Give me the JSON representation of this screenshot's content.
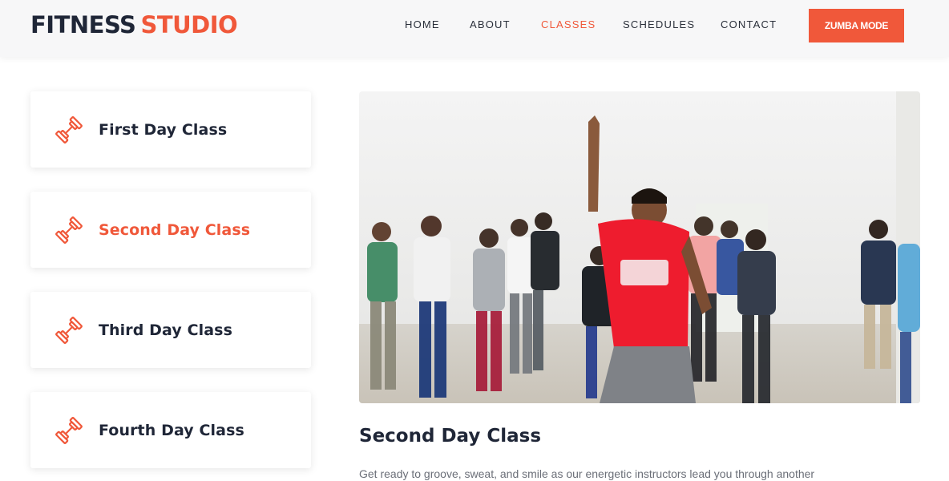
{
  "brand": {
    "part1": "FITNESS",
    "part2": "STUDIO"
  },
  "nav": {
    "home": "HOME",
    "about": "ABOUT",
    "classes": "CLASSES",
    "schedules": "SCHEDULES",
    "contact": "CONTACT",
    "cta": "ZUMBA MODE"
  },
  "classes": [
    {
      "label": "First Day Class"
    },
    {
      "label": "Second Day Class"
    },
    {
      "label": "Third Day Class"
    },
    {
      "label": "Fourth Day Class"
    }
  ],
  "selected_class_index": 1,
  "detail": {
    "title": "Second Day Class",
    "text": "Get ready to groove, sweat, and smile as our energetic instructors lead you through another"
  },
  "icons": {
    "class_card": "dumbbell-icon"
  },
  "colors": {
    "accent": "#f0583a",
    "dark": "#1f2637"
  }
}
